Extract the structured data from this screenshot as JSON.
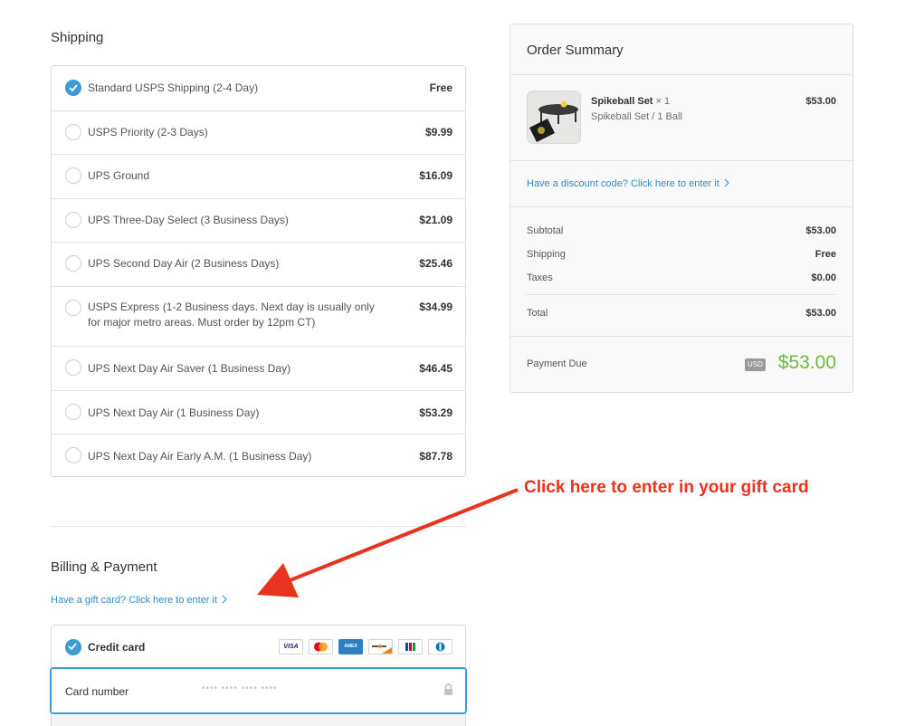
{
  "shipping": {
    "title": "Shipping",
    "options": [
      {
        "label": "Standard USPS Shipping (2-4 Day)",
        "price": "Free",
        "selected": true
      },
      {
        "label": "USPS Priority (2-3 Days)",
        "price": "$9.99",
        "selected": false
      },
      {
        "label": "UPS Ground",
        "price": "$16.09",
        "selected": false
      },
      {
        "label": "UPS Three-Day Select (3 Business Days)",
        "price": "$21.09",
        "selected": false
      },
      {
        "label": "UPS Second Day Air (2 Business Days)",
        "price": "$25.46",
        "selected": false
      },
      {
        "label": "USPS Express (1-2 Business days. Next day is usually only for major metro areas. Must order by 12pm CT)",
        "price": "$34.99",
        "selected": false
      },
      {
        "label": "UPS Next Day Air Saver (1 Business Day)",
        "price": "$46.45",
        "selected": false
      },
      {
        "label": "UPS Next Day Air (1 Business Day)",
        "price": "$53.29",
        "selected": false
      },
      {
        "label": "UPS Next Day Air Early A.M. (1 Business Day)",
        "price": "$87.78",
        "selected": false
      }
    ]
  },
  "billing": {
    "title": "Billing & Payment",
    "gift_card_link": "Have a gift card? Click here to enter it",
    "method_label": "Credit card",
    "card_brands": [
      "VISA",
      "mastercard-icon",
      "AMEX",
      "discover-icon",
      "jcb-icon",
      "diners-icon"
    ],
    "card_brand_visa": "VISA",
    "card_brand_amex": "AMEX",
    "card_number_label": "Card number",
    "card_number_placeholder": "•••• •••• •••• ••••"
  },
  "summary": {
    "title": "Order Summary",
    "item": {
      "name": "Spikeball Set",
      "qty": "× 1",
      "variant": "Spikeball Set / 1 Ball",
      "price": "$53.00"
    },
    "discount_link": "Have a discount code? Click here to enter it",
    "subtotal_label": "Subtotal",
    "subtotal": "$53.00",
    "shipping_label": "Shipping",
    "shipping": "Free",
    "taxes_label": "Taxes",
    "taxes": "$0.00",
    "total_label": "Total",
    "total": "$53.00",
    "payment_due_label": "Payment Due",
    "currency": "USD",
    "payment_due": "$53.00"
  },
  "annotation": {
    "text": "Click here to enter in your gift card",
    "color": "#e8331f"
  },
  "colors": {
    "accent": "#3a9bd6",
    "link": "#2a8fc7",
    "due_amount": "#6bb93e"
  }
}
